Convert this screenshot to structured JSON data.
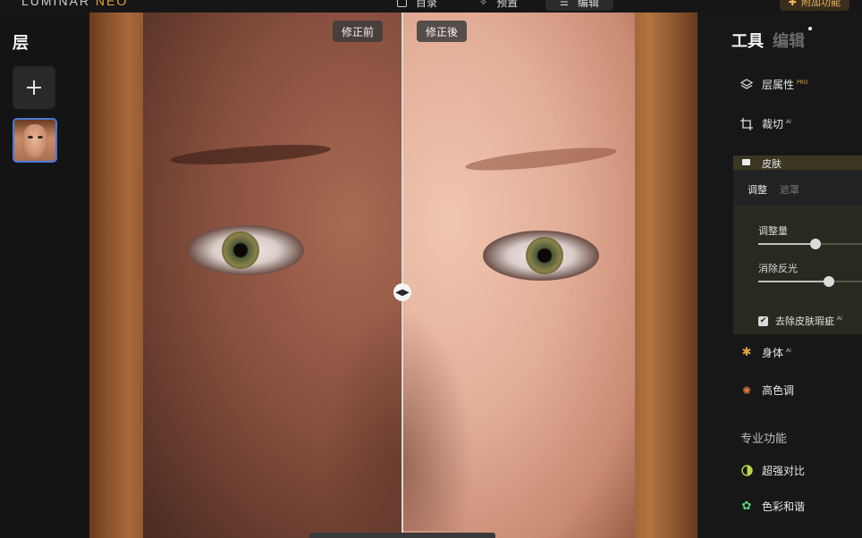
{
  "app": {
    "logo_main": "LUMINAR ",
    "logo_accent": "NEO"
  },
  "topnav": {
    "catalog": "目录",
    "presets": "预置",
    "edit": "编辑",
    "addons": "附加功能"
  },
  "layers": {
    "title": "层",
    "add_label": "+"
  },
  "canvas": {
    "before_label": "修正前",
    "after_label": "修正後",
    "split_handle": "◀▶"
  },
  "right_panel": {
    "tab_tools": "工具",
    "tab_edits": "编辑",
    "tools": [
      {
        "label": "层属性",
        "badge": "PRO",
        "icon": "layers-icon"
      },
      {
        "label": "裁切",
        "badge": "AI",
        "icon": "crop-icon"
      }
    ],
    "expanded_tool": {
      "label": "皮肤",
      "subtabs": [
        "调整",
        "遮罩"
      ],
      "sliders": [
        {
          "label": "调整量",
          "value": 0.55
        },
        {
          "label": "消除反光",
          "value": 0.68
        }
      ],
      "checkbox_label": "去除皮肤瑕疵",
      "checkbox_badge": "AI",
      "checkbox_checked": true
    },
    "tools_after": [
      {
        "label": "身体",
        "badge": "AI",
        "icon": "body-icon",
        "color": "#e3a23a"
      },
      {
        "label": "高色调",
        "badge": "",
        "icon": "sun-icon",
        "color": "#e07a3a"
      }
    ],
    "pro_section_title": "专业功能",
    "pro_tools": [
      {
        "label": "超强对比",
        "icon": "contrast-icon",
        "color": "#b8d84a"
      },
      {
        "label": "色彩和谐",
        "icon": "color-harmony-icon",
        "color": "#5ad87a"
      }
    ]
  }
}
